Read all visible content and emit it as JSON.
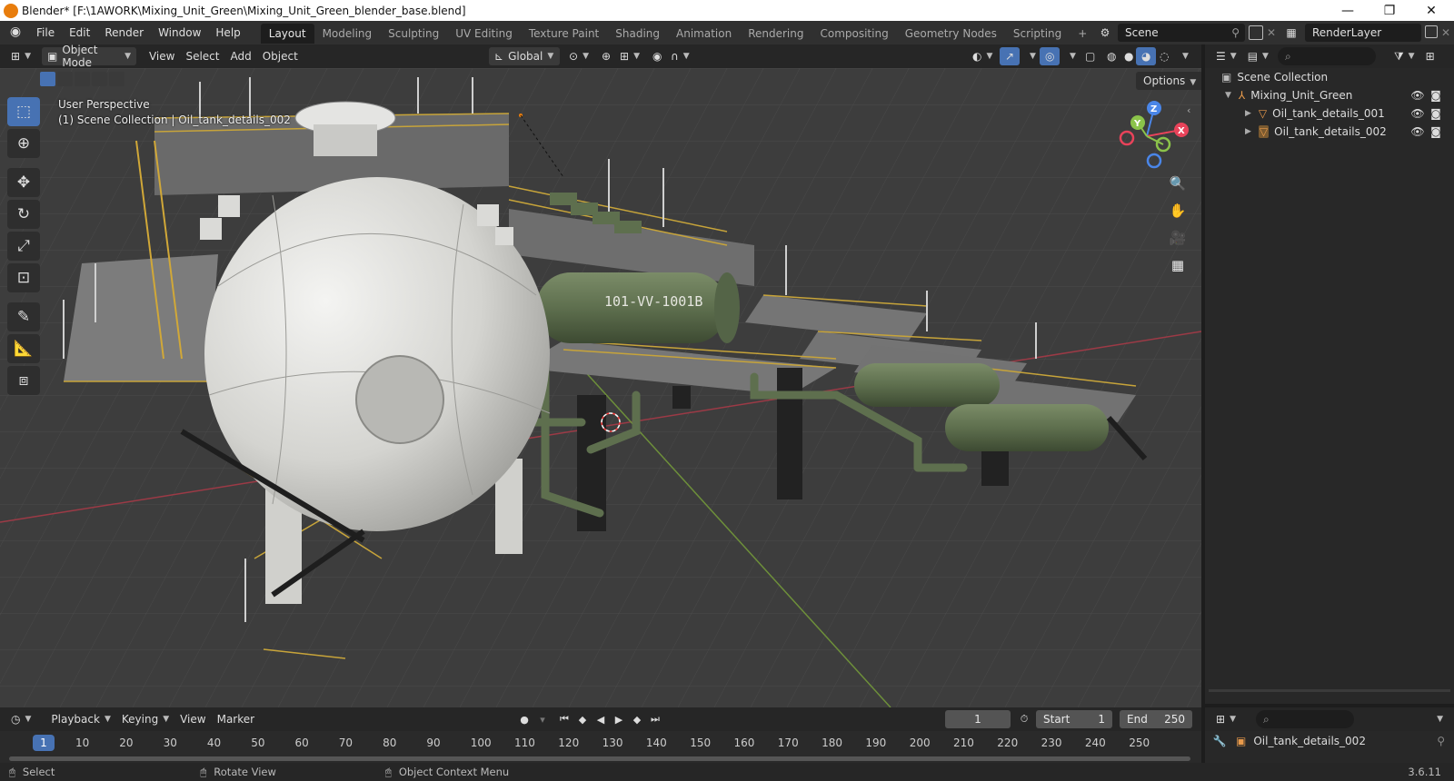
{
  "window": {
    "title": "Blender* [F:\\1AWORK\\Mixing_Unit_Green\\Mixing_Unit_Green_blender_base.blend]",
    "minimize": "—",
    "maximize": "❐",
    "close": "✕"
  },
  "menu": [
    "File",
    "Edit",
    "Render",
    "Window",
    "Help"
  ],
  "workspaces": [
    "Layout",
    "Modeling",
    "Sculpting",
    "UV Editing",
    "Texture Paint",
    "Shading",
    "Animation",
    "Rendering",
    "Compositing",
    "Geometry Nodes",
    "Scripting"
  ],
  "active_workspace": "Layout",
  "add_workspace": "+",
  "scene": {
    "name": "Scene",
    "render_layer": "RenderLayer"
  },
  "viewport_header": {
    "mode": "Object Mode",
    "menus": [
      "View",
      "Select",
      "Add",
      "Object"
    ],
    "orientation": "Global",
    "options": "Options"
  },
  "viewport": {
    "perspective": "User Perspective",
    "collection_info": "(1) Scene Collection | Oil_tank_details_002",
    "tank_label": "101-VV-1001B",
    "gizmo": {
      "x": "X",
      "y": "Y",
      "z": "Z"
    }
  },
  "outliner": {
    "root": "Scene Collection",
    "items": [
      {
        "label": "Mixing_Unit_Green",
        "level": 1
      },
      {
        "label": "Oil_tank_details_001",
        "level": 2
      },
      {
        "label": "Oil_tank_details_002",
        "level": 2
      }
    ]
  },
  "timeline": {
    "menus": [
      "Playback",
      "Keying",
      "View",
      "Marker"
    ],
    "current_frame": "1",
    "start_label": "Start",
    "start": "1",
    "end_label": "End",
    "end": "250",
    "ticks": [
      "1",
      "10",
      "20",
      "30",
      "40",
      "50",
      "60",
      "70",
      "80",
      "90",
      "100",
      "110",
      "120",
      "130",
      "140",
      "150",
      "160",
      "170",
      "180",
      "190",
      "200",
      "210",
      "220",
      "230",
      "240",
      "250"
    ]
  },
  "properties": {
    "object": "Oil_tank_details_002"
  },
  "status": {
    "select": "Select",
    "rotate": "Rotate View",
    "context": "Object Context Menu",
    "version": "3.6.11"
  },
  "colors": {
    "accent": "#4772b3",
    "x_axis": "#e8435a",
    "y_axis": "#8bc34a",
    "z_axis": "#4a86e8",
    "tank_green": "#5d6e4e",
    "sphere": "#d8d8d6",
    "railing": "#c7a43a"
  }
}
